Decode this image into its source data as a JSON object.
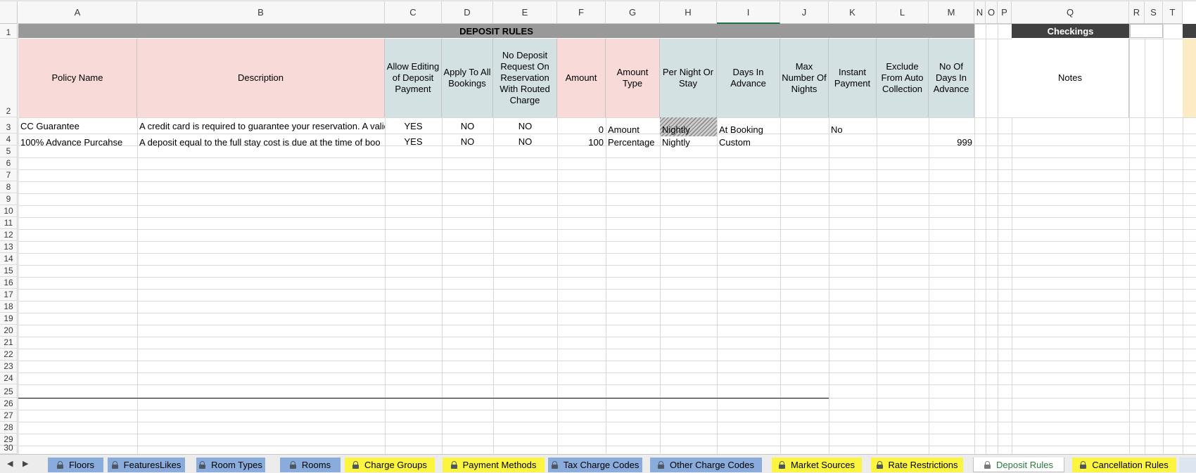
{
  "columns": [
    "A",
    "B",
    "C",
    "D",
    "E",
    "F",
    "G",
    "H",
    "I",
    "J",
    "K",
    "L",
    "M",
    "N",
    "O",
    "P",
    "Q",
    "R",
    "S",
    "T"
  ],
  "active_column": "I",
  "rows": [
    "1",
    "2",
    "3",
    "4",
    "5",
    "6",
    "7",
    "8",
    "9",
    "10",
    "11",
    "12",
    "13",
    "14",
    "15",
    "16",
    "17",
    "18",
    "19",
    "20",
    "21",
    "22",
    "23",
    "24",
    "25",
    "26",
    "27",
    "28",
    "29",
    "30"
  ],
  "title": "DEPOSIT RULES",
  "checkings_label": "Checkings",
  "headers": {
    "policy_name": "Policy Name",
    "description": "Description",
    "allow_editing": "Allow Editing of Deposit Payment",
    "apply_all": "Apply To All Bookings",
    "no_deposit": "No Deposit Request On Reservation With Routed Charge",
    "amount": "Amount",
    "amount_type": "Amount Type",
    "per_night": "Per Night Or Stay",
    "days_in_advance": "Days In Advance",
    "max_nights": "Max Number Of Nights",
    "instant_payment": "Instant Payment",
    "exclude_auto": "Exclude From Auto Collection",
    "no_of_days": "No Of Days In Advance",
    "notes": "Notes"
  },
  "data_rows": [
    {
      "policy_name": "CC Guarantee",
      "description": "A credit card is required to guarantee your reservation. A valid",
      "allow_editing": "YES",
      "apply_all": "NO",
      "no_deposit": "NO",
      "amount": "0",
      "amount_type": "Amount",
      "per_night": "Nightly",
      "days_in_advance": "At Booking",
      "max_nights": "",
      "instant_payment": "No",
      "exclude_auto": "",
      "no_of_days": ""
    },
    {
      "policy_name": "100% Advance Purcahse",
      "description": "A deposit equal to the full stay cost is due at the time of boo",
      "allow_editing": "YES",
      "apply_all": "NO",
      "no_deposit": "NO",
      "amount": "100",
      "amount_type": "Percentage",
      "per_night": "Nightly",
      "days_in_advance": "Custom",
      "max_nights": "",
      "instant_payment": "",
      "exclude_auto": "",
      "no_of_days": "999"
    }
  ],
  "sheet_tabs": [
    {
      "label": "Floors",
      "color": "blue",
      "locked": true,
      "active": false
    },
    {
      "label": "FeaturesLikes",
      "color": "blue",
      "locked": true,
      "active": false
    },
    {
      "label": "Room Types",
      "color": "blue",
      "locked": true,
      "active": false
    },
    {
      "label": "Rooms",
      "color": "blue",
      "locked": true,
      "active": false
    },
    {
      "label": "Charge Groups",
      "color": "yellow",
      "locked": true,
      "active": false
    },
    {
      "label": "Payment Methods",
      "color": "yellow",
      "locked": true,
      "active": false
    },
    {
      "label": "Tax Charge Codes",
      "color": "blue",
      "locked": true,
      "active": false
    },
    {
      "label": "Other Charge Codes",
      "color": "blue",
      "locked": true,
      "active": false
    },
    {
      "label": "Market Sources",
      "color": "yellow",
      "locked": true,
      "active": false
    },
    {
      "label": "Rate Restrictions",
      "color": "yellow",
      "locked": true,
      "active": false
    },
    {
      "label": "Deposit Rules",
      "color": "white",
      "locked": true,
      "active": true
    },
    {
      "label": "Cancellation Rules",
      "color": "yellow",
      "locked": true,
      "active": false
    }
  ],
  "nav": {
    "prev": "◀",
    "next": "▶"
  },
  "colors": {
    "pink_header": "#f8dad9",
    "blue_header": "#d3e1e3",
    "title_bar": "#999999",
    "checkings_bar": "#404040",
    "tab_blue": "#89acdc",
    "tab_yellow": "#fcf53f",
    "active_tab_text": "#2b7a3d"
  }
}
